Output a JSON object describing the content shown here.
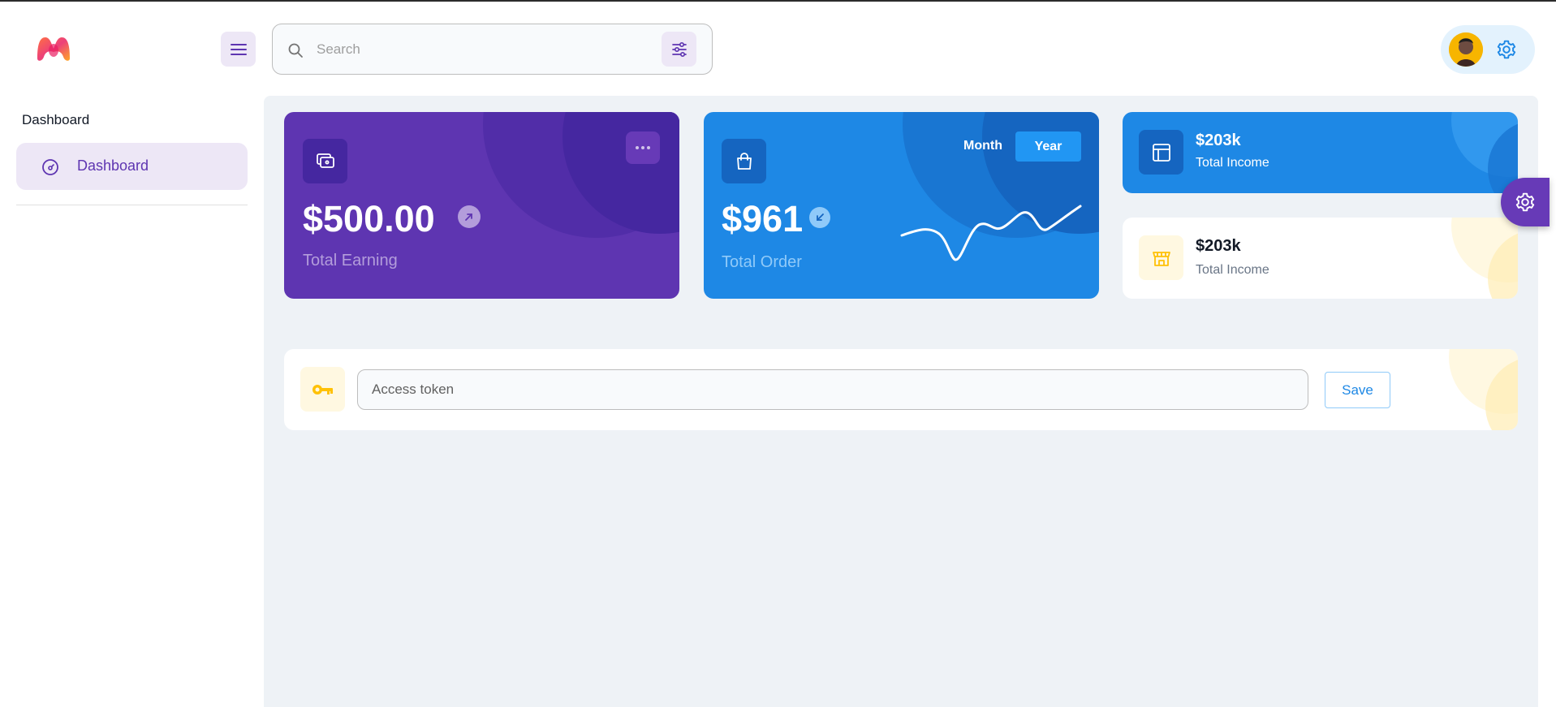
{
  "header": {
    "search": {
      "placeholder": "Search",
      "value": ""
    }
  },
  "sidebar": {
    "section_caption": "Dashboard",
    "items": [
      {
        "label": "Dashboard",
        "icon": "dashboard-gauge-icon",
        "active": true
      }
    ]
  },
  "cards": {
    "earning": {
      "value": "$500.00",
      "label": "Total Earning",
      "trend": "up"
    },
    "order": {
      "value": "$961",
      "label": "Total Order",
      "trend": "down",
      "toggle": {
        "month_label": "Month",
        "year_label": "Year",
        "selected": "Year"
      }
    },
    "income_dark": {
      "value": "$203k",
      "label": "Total Income"
    },
    "income_light": {
      "value": "$203k",
      "label": "Total Income"
    }
  },
  "token_form": {
    "placeholder": "Access token",
    "value": "",
    "save_label": "Save"
  },
  "colors": {
    "primary_purple": "#5e35b1",
    "primary_blue": "#1e88e5",
    "accent_yellow": "#ffc107",
    "background": "#eef2f6"
  }
}
